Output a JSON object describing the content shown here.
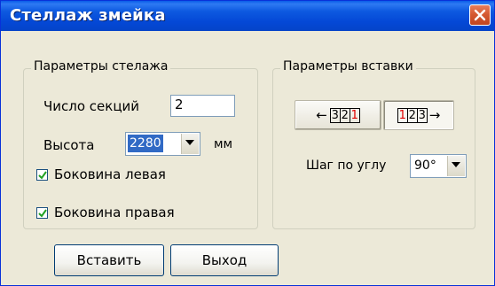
{
  "window": {
    "title": "Стеллаж змейка"
  },
  "rack_params": {
    "title": "Параметры стелажа",
    "sections_label": "Число секций",
    "sections_value": "2",
    "height_label": "Высота",
    "height_value": "2280",
    "height_unit": "мм",
    "left_side_label": "Боковина левая",
    "left_side_checked": true,
    "right_side_label": "Боковина правая",
    "right_side_checked": true
  },
  "insert_params": {
    "title": "Параметры вставки",
    "order_reverse": {
      "arrow": "←",
      "digits": [
        "3",
        "2",
        "1"
      ],
      "red_digit_index": 2,
      "selected": false
    },
    "order_forward": {
      "arrow": "→",
      "digits": [
        "1",
        "2",
        "3"
      ],
      "red_digit_index": 0,
      "selected": true
    },
    "angle_step_label": "Шаг по углу",
    "angle_step_value": "90°"
  },
  "buttons": {
    "insert": "Вставить",
    "exit": "Выход"
  },
  "icons": {
    "close": "close-icon",
    "dropdown": "chevron-down-icon",
    "check": "checkmark-icon"
  },
  "colors": {
    "titlebar": "#0448d6",
    "dialog_bg": "#ece9d8",
    "selection": "#316ac5",
    "red_digit": "#e00000"
  }
}
